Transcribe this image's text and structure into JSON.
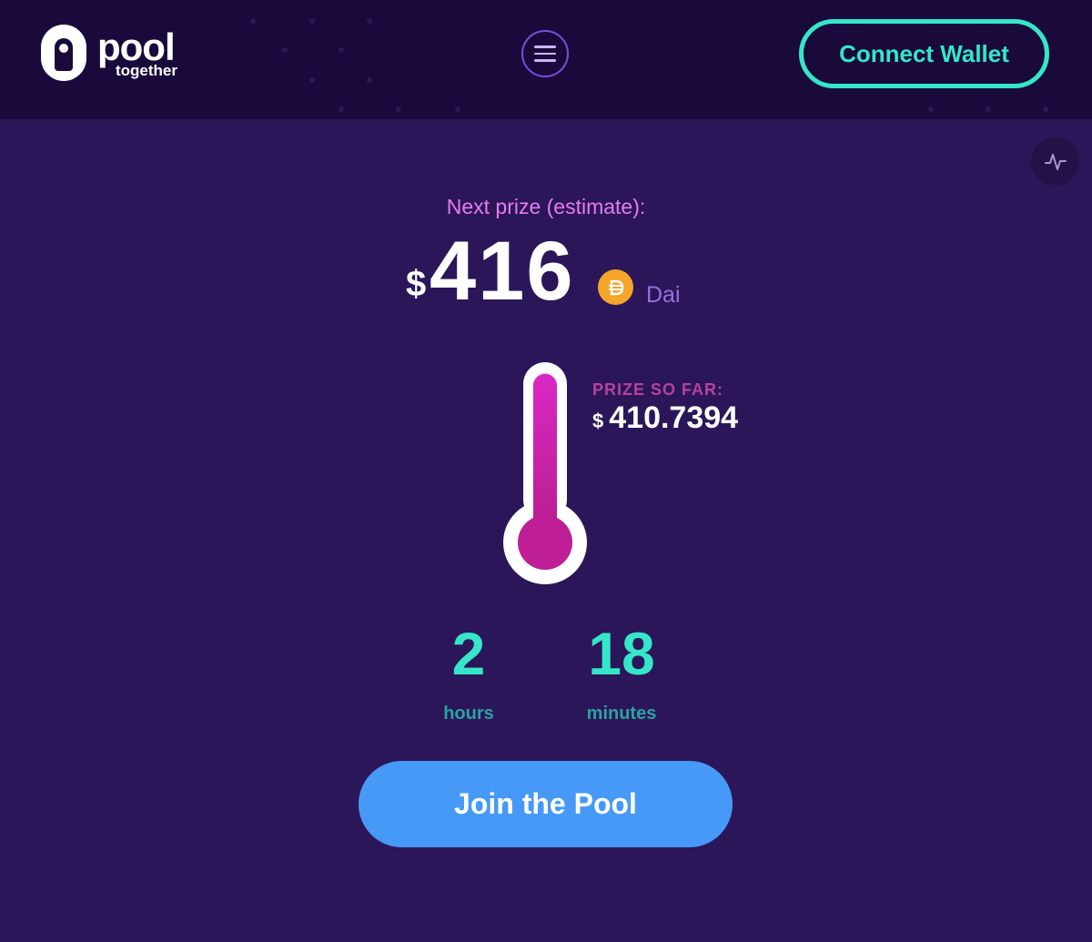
{
  "header": {
    "logo": {
      "word": "pool",
      "sub": "together"
    },
    "connect_label": "Connect Wallet"
  },
  "prize": {
    "label": "Next prize (estimate):",
    "currency_symbol": "$",
    "amount": "416",
    "token": "Dai",
    "token_color": "#f4a62a"
  },
  "progress": {
    "label": "PRIZE SO FAR:",
    "currency_symbol": "$",
    "value": "410.7394",
    "fill_fraction": 0.99
  },
  "countdown": {
    "hours_value": "2",
    "hours_label": "hours",
    "minutes_value": "18",
    "minutes_label": "minutes"
  },
  "cta": {
    "join_label": "Join the Pool"
  },
  "colors": {
    "accent": "#35e6c9",
    "primary_button": "#4699f6",
    "thermometer_fill": "#c41fa8",
    "background": "#2b1659"
  }
}
